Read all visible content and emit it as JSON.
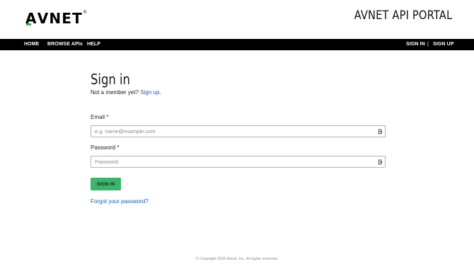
{
  "header": {
    "logo_text_a": "A",
    "logo_text_rest": "VNET",
    "logo_tm": "®",
    "portal_title": "AVNET API PORTAL"
  },
  "nav": {
    "left": [
      {
        "label": "HOME"
      },
      {
        "label": "BROWSE APIs"
      },
      {
        "label": "HELP"
      }
    ],
    "right": [
      {
        "label": "SIGN IN"
      },
      {
        "label": "SIGN UP"
      }
    ],
    "separator": "|"
  },
  "signin": {
    "title": "Sign in",
    "not_member": "Not a member yet?",
    "signup_link": "Sign up",
    "period": ".",
    "email_label": "Email *",
    "email_placeholder": "e.g. name@example.com",
    "email_value": "",
    "password_label": "Password *",
    "password_placeholder": "Password",
    "password_value": "",
    "submit_label": "SIGN IN",
    "forgot_link": "Forgot your password?"
  },
  "footer": {
    "copyright": "© Copyright 2024 Avnet, Inc. All rights reserved."
  },
  "colors": {
    "nav_bg": "#000000",
    "accent_green": "#3db36b",
    "link_blue": "#1a5fb4"
  },
  "icons": {
    "field_icon": "password-manager-key-icon"
  }
}
